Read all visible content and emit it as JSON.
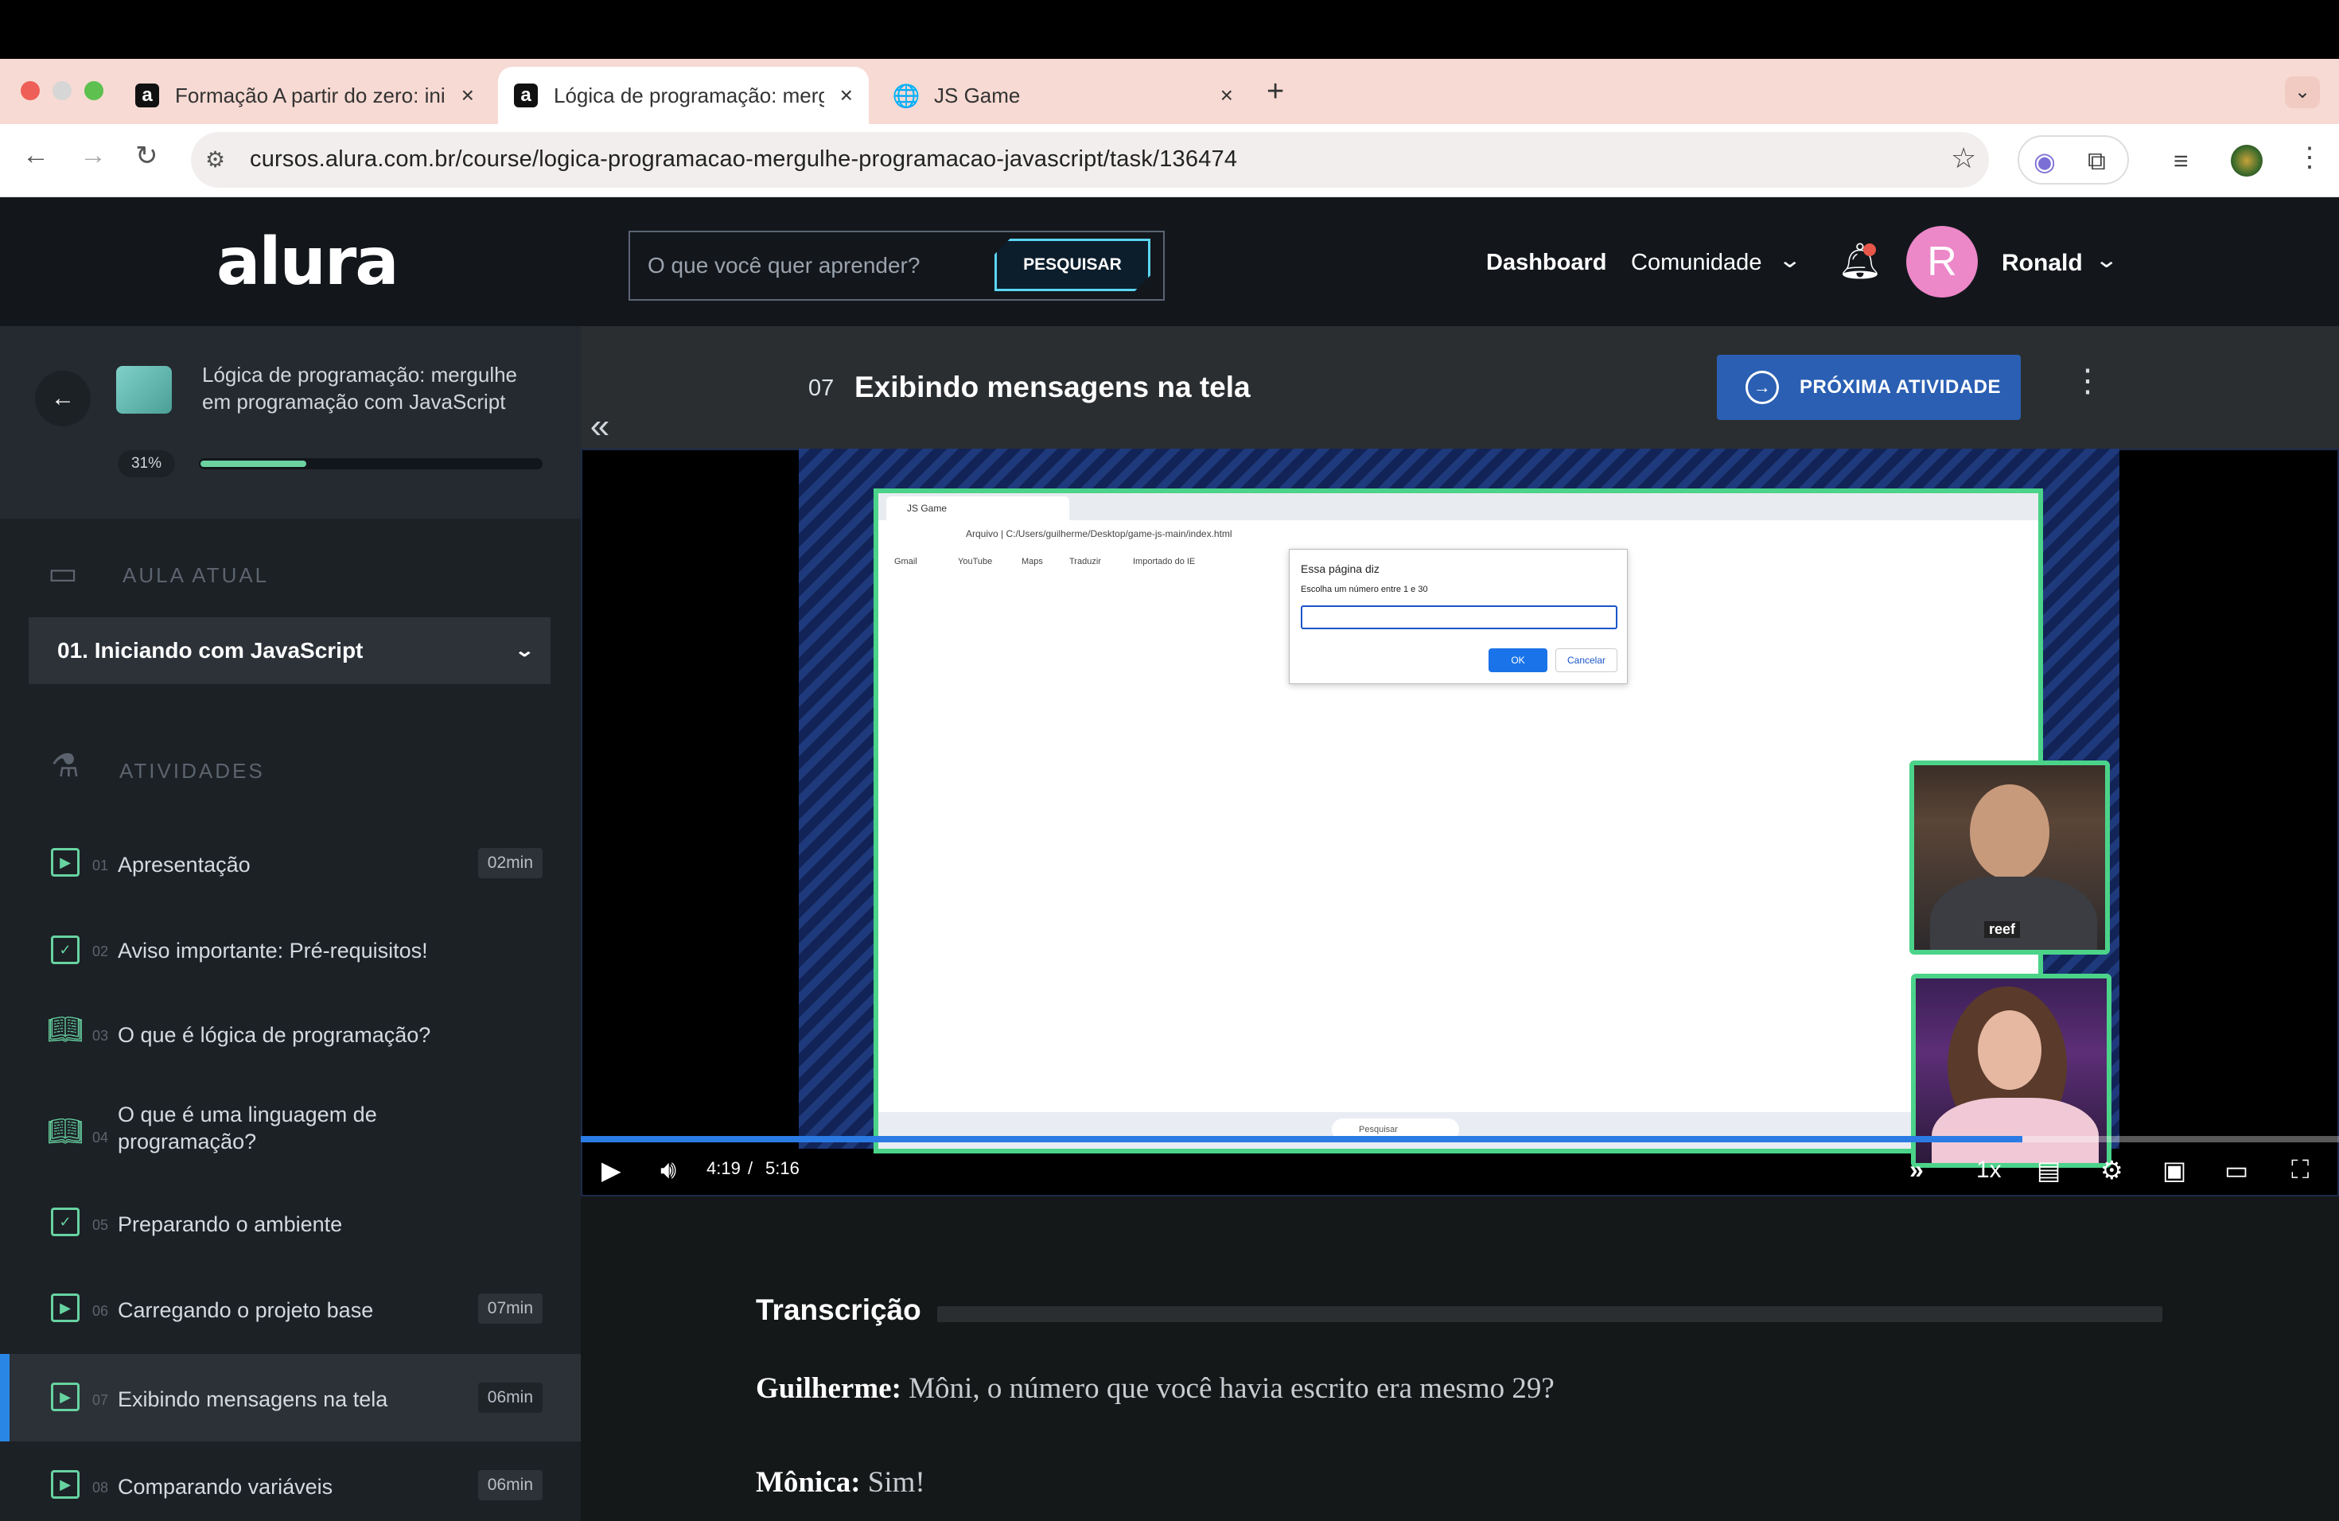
{
  "browser": {
    "tabs": [
      {
        "title": "Formação A partir do zero: iniciante em programação",
        "icon": "alura-favicon"
      },
      {
        "title": "Lógica de programação: mergulhe em programação com JavaScript",
        "icon": "alura-favicon",
        "active": true
      },
      {
        "title": "JS Game",
        "icon": "globe-icon"
      }
    ],
    "url": "cursos.alura.com.br/course/logica-programacao-mergulhe-programacao-javascript/task/136474"
  },
  "header": {
    "logo": "alura",
    "search_placeholder": "O que você quer aprender?",
    "search_button": "PESQUISAR",
    "nav_dashboard": "Dashboard",
    "nav_community": "Comunidade",
    "user_initial": "R",
    "user_name": "Ronald"
  },
  "sidebar": {
    "course_title": "Lógica de programação: mergulhe em programação com JavaScript",
    "progress_label": "31%",
    "progress": 0.31,
    "current_lesson_label": "AULA ATUAL",
    "current_lesson": "01. Iniciando com JavaScript",
    "activities_label": "ATIVIDADES",
    "activities": [
      {
        "num": "01",
        "name": "Apresentação",
        "duration": "02min",
        "icon": "video-icon"
      },
      {
        "num": "02",
        "name": "Aviso importante: Pré-requisitos!",
        "duration": "",
        "icon": "checklist-icon"
      },
      {
        "num": "03",
        "name": "O que é lógica de programação?",
        "duration": "",
        "icon": "book-icon"
      },
      {
        "num": "04",
        "name": "O que é uma linguagem de programação?",
        "duration": "",
        "icon": "book-icon"
      },
      {
        "num": "05",
        "name": "Preparando o ambiente",
        "duration": "",
        "icon": "checklist-icon"
      },
      {
        "num": "06",
        "name": "Carregando o projeto base",
        "duration": "07min",
        "icon": "video-icon"
      },
      {
        "num": "07",
        "name": "Exibindo mensagens na tela",
        "duration": "06min",
        "icon": "video-icon",
        "current": true
      },
      {
        "num": "08",
        "name": "Comparando variáveis",
        "duration": "06min",
        "icon": "video-icon"
      }
    ]
  },
  "task": {
    "number": "07",
    "title": "Exibindo mensagens na tela",
    "next_button": "PRÓXIMA ATIVIDADE"
  },
  "video": {
    "current_time": "4:19",
    "separator": "/",
    "total_time": "5:16",
    "progress": 0.82,
    "speed": "1x",
    "inner_screen": {
      "tab_title": "JS Game",
      "address": "Arquivo | C:/Users/guilherme/Desktop/game-js-main/index.html",
      "bookmarks": [
        "Gmail",
        "YouTube",
        "Maps",
        "Traduzir",
        "Importado do IE"
      ],
      "dialog_title": "Essa página diz",
      "dialog_text": "Escolha um número entre 1 e 30",
      "dialog_ok": "OK",
      "dialog_cancel": "Cancelar",
      "taskbar_search": "Pesquisar",
      "shirt_text": "reef"
    }
  },
  "transcript": {
    "title": "Transcrição",
    "lines": [
      {
        "speaker": "Guilherme:",
        "text": "Môni, o número que você havia escrito era mesmo 29?"
      },
      {
        "speaker": "Mônica:",
        "text": "Sim!"
      }
    ]
  }
}
